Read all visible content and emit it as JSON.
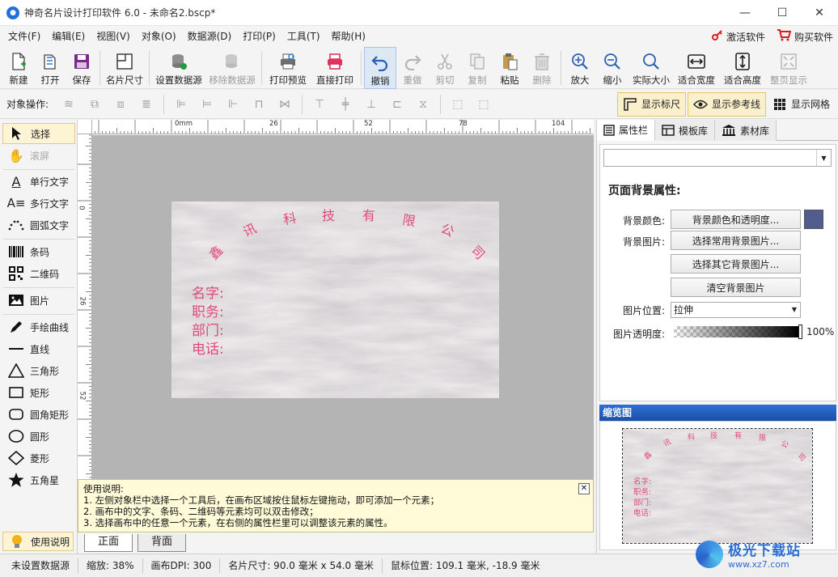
{
  "window": {
    "title": "神奇名片设计打印软件 6.0 - 未命名2.bscp*",
    "minimize": "—",
    "maximize": "☐",
    "close": "✕"
  },
  "menu": {
    "items": [
      "文件(F)",
      "编辑(E)",
      "视图(V)",
      "对象(O)",
      "数据源(D)",
      "打印(P)",
      "工具(T)",
      "帮助(H)"
    ],
    "activate": "激活软件",
    "buy": "购买软件"
  },
  "toolbar": {
    "new": "新建",
    "open": "打开",
    "save": "保存",
    "card_size": "名片尺寸",
    "set_datasource": "设置数据源",
    "remove_datasource": "移除数据源",
    "print_preview": "打印预览",
    "direct_print": "直接打印",
    "undo": "撤销",
    "redo": "重做",
    "cut": "剪切",
    "copy": "复制",
    "paste": "粘贴",
    "delete": "删除",
    "zoom_in": "放大",
    "zoom_out": "缩小",
    "actual_size": "实际大小",
    "fit_width": "适合宽度",
    "fit_height": "适合高度",
    "full_page": "整页显示"
  },
  "objbar": {
    "label": "对象操作:",
    "show_ruler": "显示标尺",
    "show_guides": "显示参考线",
    "show_grid": "显示网格"
  },
  "tools": {
    "select": "选择",
    "scroll": "滚屏",
    "single_text": "单行文字",
    "multi_text": "多行文字",
    "arc_text": "圆弧文字",
    "barcode": "条码",
    "qrcode": "二维码",
    "image": "图片",
    "freehand": "手绘曲线",
    "line": "直线",
    "triangle": "三角形",
    "rect": "矩形",
    "round_rect": "圆角矩形",
    "ellipse": "圆形",
    "diamond": "菱形",
    "star": "五角星",
    "help": "使用说明"
  },
  "ruler": {
    "top": [
      "0mm",
      "26",
      "52",
      "78",
      "104"
    ],
    "left": [
      "0",
      "26",
      "52"
    ]
  },
  "card": {
    "arc_chars": [
      "鑫",
      "讯",
      "科",
      "技",
      "有",
      "限",
      "公",
      "司"
    ],
    "fields": [
      "名字:",
      "职务:",
      "部门:",
      "电话:"
    ]
  },
  "help": {
    "title": "使用说明:",
    "lines": [
      "1. 左侧对象栏中选择一个工具后，在画布区域按住鼠标左键拖动，即可添加一个元素；",
      "2. 画布中的文字、条码、二维码等元素均可以双击修改；",
      "3. 选择画布中的任意一个元素，在右侧的属性栏里可以调整该元素的属性。"
    ],
    "close": "✕"
  },
  "page_tabs": [
    "正面",
    "背面"
  ],
  "right": {
    "tabs": [
      "属性栏",
      "模板库",
      "素材库"
    ],
    "combo_value": "",
    "section_title": "页面背景属性:",
    "bg_color_label": "背景颜色:",
    "bg_color_btn": "背景颜色和透明度...",
    "bg_color_value": "#525c8f",
    "bg_image_label": "背景图片:",
    "pick_common": "选择常用背景图片...",
    "pick_other": "选择其它背景图片...",
    "clear_bg": "清空背景图片",
    "image_pos_label": "图片位置:",
    "image_pos_value": "拉伸",
    "opacity_label": "图片透明度:",
    "opacity_value": "100%",
    "preview_title": "缩览图"
  },
  "status": {
    "datasource": "未设置数据源",
    "zoom": "缩放: 38%",
    "dpi": "画布DPI: 300",
    "card_size": "名片尺寸: 90.0 毫米 x 54.0 毫米",
    "mouse_pos": "鼠标位置: 109.1 毫米, -18.9 毫米"
  },
  "watermark": {
    "name": "极光下载站",
    "url": "www.xz7.com"
  },
  "colors": {
    "accent": "#2b6ed2",
    "card_text": "#e0487a",
    "red_icon": "#d62020"
  }
}
